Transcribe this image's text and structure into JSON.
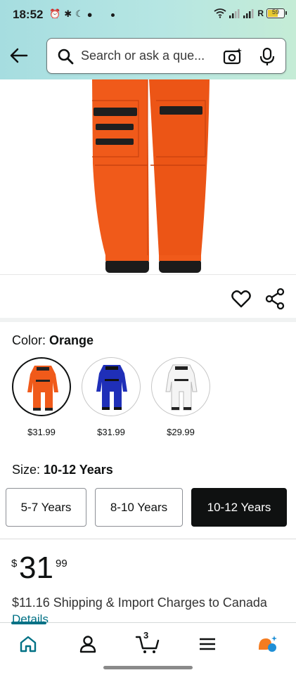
{
  "status_bar": {
    "time": "18:52",
    "left_icons": [
      "alarm-icon",
      "bluetooth-icon",
      "moon-icon",
      "chat-icon"
    ],
    "right_icons": [
      "wifi-icon",
      "signal-icon",
      "signal-icon",
      "r-indicator",
      "battery-icon"
    ],
    "r_label": "R",
    "battery_level": "59"
  },
  "search": {
    "placeholder": "Search or ask a que...",
    "back_icon": "arrow-left-icon",
    "camera_icon": "camera-sparkle-icon",
    "mic_icon": "mic-icon"
  },
  "product_image": {
    "subject": "orange-astronaut-costume-pants",
    "colors": {
      "fabric": "#f05a1a",
      "cuff": "#1b1b1b",
      "zipper": "#222222"
    }
  },
  "actions": {
    "wishlist_icon": "heart-icon",
    "share_icon": "share-icon"
  },
  "color": {
    "label": "Color:",
    "selected": "Orange",
    "options": [
      {
        "fill": "#f05a1a",
        "price": "$31.99"
      },
      {
        "fill": "#1f2fb8",
        "price": "$31.99"
      },
      {
        "fill": "#f4f4f4",
        "price": "$29.99"
      }
    ]
  },
  "size": {
    "label": "Size:",
    "selected": "10-12 Years",
    "options": [
      "5-7 Years",
      "8-10 Years",
      "10-12 Years"
    ]
  },
  "price": {
    "symbol": "$",
    "whole": "31",
    "cents": "99"
  },
  "shipping": {
    "text": "$11.16 Shipping & Import Charges to Canada",
    "details": "Details"
  },
  "bottom_nav": {
    "items": [
      "home-icon",
      "account-icon",
      "cart-icon",
      "menu-icon",
      "rufus-icon"
    ],
    "cart_count": "3",
    "accent": "#007185"
  }
}
